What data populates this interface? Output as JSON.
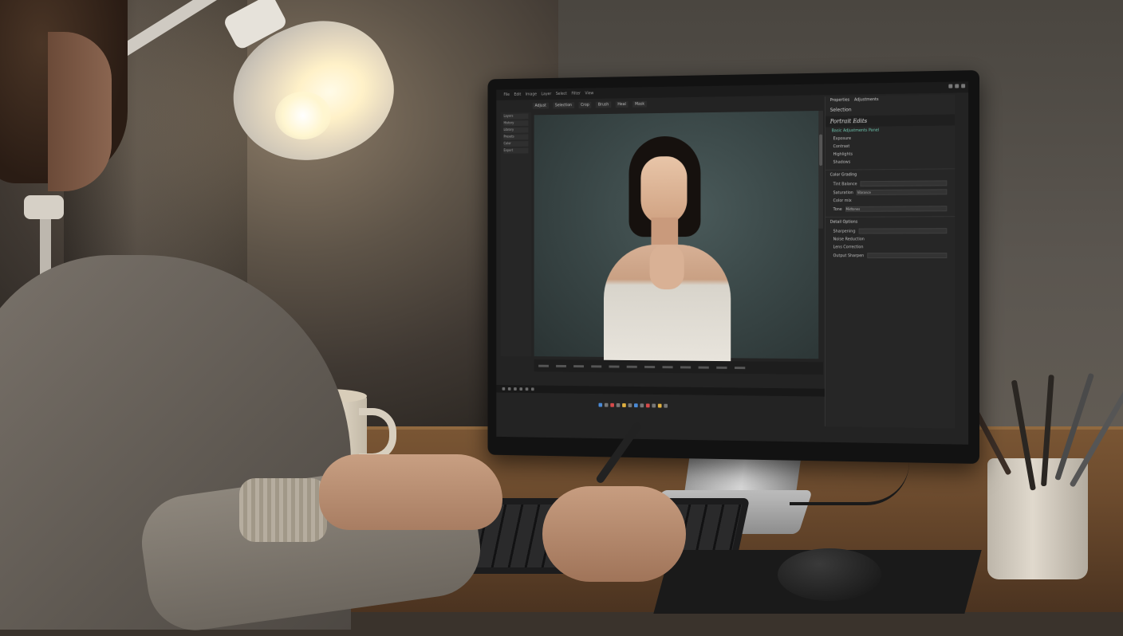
{
  "app": {
    "menu": [
      "File",
      "Edit",
      "Image",
      "Layer",
      "Select",
      "Filter",
      "View"
    ],
    "toolbar": [
      "Adjust",
      "Selection",
      "Crop",
      "Brush",
      "Heal",
      "Mask"
    ],
    "left_panel": [
      "Layers",
      "History",
      "Library",
      "Presets",
      "Color",
      "Export"
    ],
    "right_panel": {
      "header_tabs": [
        "Properties",
        "Adjustments"
      ],
      "icon_row_label": "Selection",
      "title": "Portrait Edits",
      "subtitle": "Basic Adjustments Panel",
      "list": [
        "Exposure",
        "Contrast",
        "Highlights",
        "Shadows"
      ],
      "section1": "Color Grading",
      "rows": [
        {
          "label": "Tint Balance",
          "value": ""
        },
        {
          "label": "Saturation",
          "value": "Vibrance"
        },
        {
          "label": "Color mix",
          "value": ""
        },
        {
          "label": "Tone",
          "value": "Midtones"
        }
      ],
      "section2": "Detail Options",
      "detail_rows": [
        "Sharpening",
        "Noise Reduction",
        "Lens Correction",
        "Output Sharpen"
      ]
    }
  }
}
